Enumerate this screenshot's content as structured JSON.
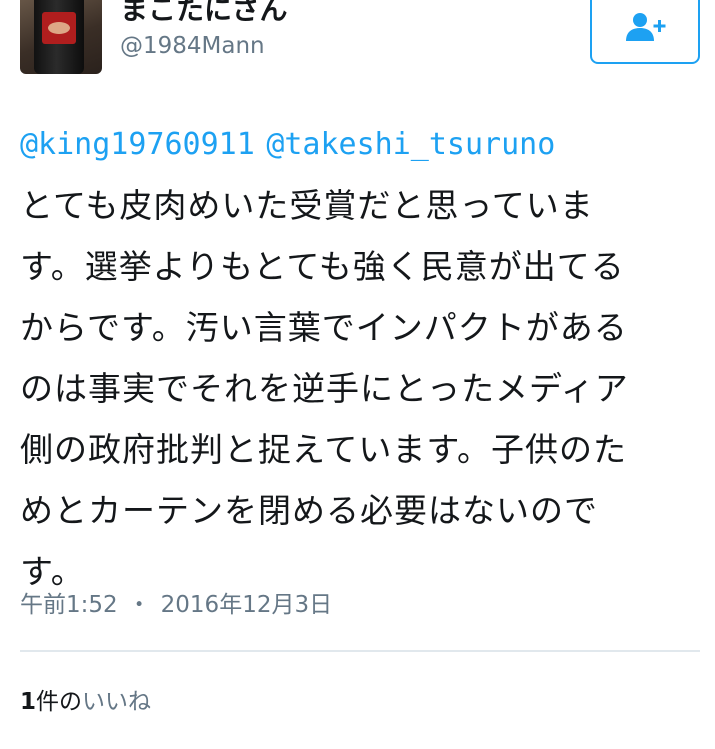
{
  "user": {
    "display_name": "まこたにさん",
    "handle": "@1984Mann"
  },
  "follow_button": {
    "icon": "add-user-icon",
    "color": "#1da1f2"
  },
  "tweet": {
    "mentions": [
      "@king19760911",
      "@takeshi_tsuruno"
    ],
    "lines": [
      "とても皮肉めいた受賞だと思っていま",
      "す。選挙よりもとても強く民意が出てる",
      "からです。汚い言葉でインパクトがある",
      "のは事実でそれを逆手にとったメディア",
      "側の政府批判と捉えています。子供のた",
      "めとカーテンを閉める必要はないので",
      "す。"
    ]
  },
  "meta": {
    "time": "午前1:52",
    "separator": "・",
    "date": "2016年12月3日"
  },
  "likes": {
    "count": "1",
    "unit": "件の",
    "label": "いいね"
  },
  "colors": {
    "accent": "#1da1f2",
    "muted": "#657786",
    "text": "#14171a"
  }
}
